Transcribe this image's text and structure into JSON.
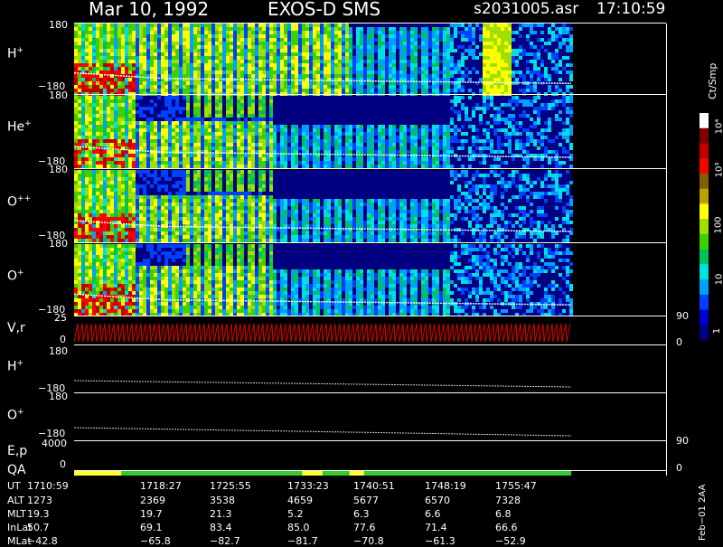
{
  "header": {
    "date": "Mar 10, 1992",
    "instrument": "EXOS-D SMS",
    "file": "s2031005.asr",
    "time": "17:10:59"
  },
  "panels": [
    {
      "id": "H",
      "label": "H",
      "sup": "+",
      "top_tick": "180",
      "bottom_tick": "−180"
    },
    {
      "id": "He",
      "label": "He",
      "sup": "+",
      "top_tick": "180",
      "bottom_tick": "−180"
    },
    {
      "id": "O2",
      "label": "O",
      "sup": "++",
      "top_tick": "180",
      "bottom_tick": "−180"
    },
    {
      "id": "O",
      "label": "O",
      "sup": "+",
      "top_tick": "180",
      "bottom_tick": "−180"
    }
  ],
  "vr": {
    "label": "V,r",
    "top_tick": "25",
    "bottom_tick": "0",
    "right_top": "90",
    "right_bottom": "0"
  },
  "h_line": {
    "label": "H",
    "sup": "+",
    "top_tick": "180",
    "bottom_tick": "−180"
  },
  "o_line": {
    "label": "O",
    "sup": "+",
    "top_tick": "180",
    "bottom_tick": "−180"
  },
  "ep": {
    "label": "E,p",
    "top_tick": "4000",
    "right_top": "90"
  },
  "qa": {
    "label": "QA",
    "bottom_tick": "0",
    "right_bottom": "0"
  },
  "colorbar": {
    "unit": "Ct/Smp",
    "ticks": [
      "10⁴",
      "10³",
      "100",
      "10",
      "1"
    ]
  },
  "qa_bar": [
    {
      "color": "#ffff33",
      "from": 0,
      "to": 0.08
    },
    {
      "color": "#33cc33",
      "from": 0.08,
      "to": 0.385
    },
    {
      "color": "#ffff33",
      "from": 0.385,
      "to": 0.42
    },
    {
      "color": "#33cc33",
      "from": 0.42,
      "to": 0.465
    },
    {
      "color": "#ffff33",
      "from": 0.465,
      "to": 0.49
    },
    {
      "color": "#33cc33",
      "from": 0.49,
      "to": 0.84
    },
    {
      "color": "#000000",
      "from": 0.84,
      "to": 1.0
    }
  ],
  "footer": {
    "rows": [
      "UT",
      "ALT",
      "MLT",
      "InLat",
      "MLat"
    ],
    "columns": [
      {
        "UT": "1710:59",
        "ALT": "1273",
        "MLT": "19.3",
        "InLat": "50.7",
        "MLat": "−42.8"
      },
      {
        "UT": "1718:27",
        "ALT": "2369",
        "MLT": "19.7",
        "InLat": "69.1",
        "MLat": "−65.8"
      },
      {
        "UT": "1725:55",
        "ALT": "3538",
        "MLT": "21.3",
        "InLat": "83.4",
        "MLat": "−82.7"
      },
      {
        "UT": "1733:23",
        "ALT": "4659",
        "MLT": "5.2",
        "InLat": "85.0",
        "MLat": "−81.7"
      },
      {
        "UT": "1740:51",
        "ALT": "5677",
        "MLT": "6.3",
        "InLat": "77.6",
        "MLat": "−70.8"
      },
      {
        "UT": "1748:19",
        "ALT": "6570",
        "MLT": "6.6",
        "InLat": "71.4",
        "MLat": "−61.3"
      },
      {
        "UT": "1755:47",
        "ALT": "7328",
        "MLT": "6.8",
        "InLat": "66.6",
        "MLat": "−52.9"
      }
    ],
    "side_stamp": "Feb−01 2AA"
  },
  "chart_data": {
    "type": "heatmap",
    "title": "Mar 10, 1992   EXOS-D SMS",
    "x_unit": "UT",
    "x_ticks": [
      "1710:59",
      "1718:27",
      "1725:55",
      "1733:23",
      "1740:51",
      "1748:19",
      "1755:47"
    ],
    "panels": [
      "H+",
      "He+",
      "O++",
      "O+"
    ],
    "ylim": [
      -180,
      180
    ],
    "color_scale": "log",
    "color_range": [
      1,
      10000
    ],
    "color_unit": "Ct/Smp",
    "colors": [
      "#000080",
      "#0000cc",
      "#0040ff",
      "#00a0ff",
      "#00e0e0",
      "#00c060",
      "#40d000",
      "#a0e000",
      "#ffff00",
      "#c0a000",
      "#806000",
      "#ff0000",
      "#c00000",
      "#800000",
      "#ffffff"
    ]
  }
}
